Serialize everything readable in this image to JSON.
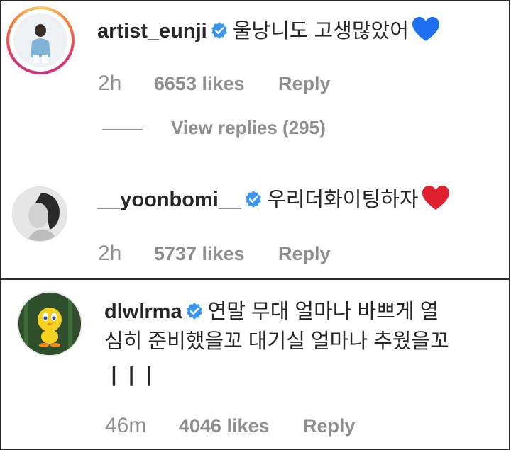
{
  "comments": [
    {
      "username": "artist_eunji",
      "text": "울낭니도 고생많았어",
      "emoji": "blue-heart",
      "time": "2h",
      "likes": "6653 likes",
      "reply_label": "Reply",
      "view_replies": "View replies (295)",
      "has_story_ring": true
    },
    {
      "username": "__yoonbomi__",
      "text": "우리더화이팅하자",
      "emoji": "red-heart",
      "time": "2h",
      "likes": "5737 likes",
      "reply_label": "Reply"
    },
    {
      "username": "dlwlrma",
      "text_line1": "연말 무대 얼마나 바쁘게 열",
      "text_line2": "심히 준비했을꼬 대기실 얼마나 추웠을꼬",
      "text_line3": "ㅣㅣㅣ",
      "time": "46m",
      "likes": "4046 likes",
      "reply_label": "Reply"
    }
  ],
  "colors": {
    "verified": "#3897f0",
    "meta_text": "#8e8e8e",
    "primary_text": "#262626",
    "blue_heart": "#1e6ff0",
    "red_heart": "#e0202c"
  }
}
